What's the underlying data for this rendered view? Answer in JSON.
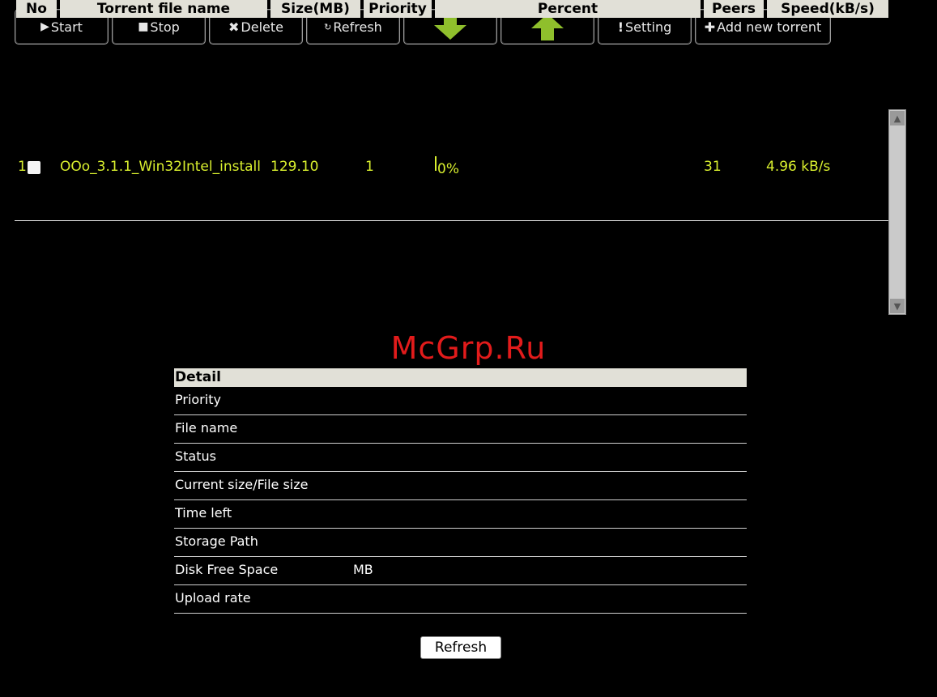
{
  "toolbar": {
    "start": "Start",
    "stop": "Stop",
    "delete": "Delete",
    "refresh": "Refresh",
    "setting": "Setting",
    "add": "Add new torrent",
    "icons": {
      "start": "play-icon",
      "stop": "stop-icon",
      "delete": "x-icon",
      "refresh": "refresh-icon",
      "down": "down-arrow-icon",
      "up": "up-arrow-icon",
      "setting": "exclamation-icon",
      "add": "plus-icon"
    },
    "arrow_color": "#8fbf2c"
  },
  "table": {
    "headers": [
      "No",
      "Torrent file name",
      "Size(MB)",
      "Priority",
      "Percent",
      "Peers",
      "Speed(kB/s)"
    ],
    "rows": [
      {
        "no": "1",
        "name": "OOo_3.1.1_Win32Intel_install",
        "size": "129.10",
        "priority": "1",
        "percent": "0%",
        "peers": "31",
        "speed": "4.96 kB/s"
      }
    ],
    "row_text_color": "#d9ef2e"
  },
  "watermark": "McGrp.Ru",
  "detail": {
    "title": "Detail",
    "rows": [
      {
        "label": "Priority",
        "value": ""
      },
      {
        "label": "File name",
        "value": ""
      },
      {
        "label": "Status",
        "value": ""
      },
      {
        "label": "Current size/File size",
        "value": ""
      },
      {
        "label": "Time left",
        "value": ""
      },
      {
        "label": "Storage Path",
        "value": ""
      },
      {
        "label": "Disk Free Space",
        "value": "MB"
      },
      {
        "label": "Upload rate",
        "value": ""
      }
    ]
  },
  "refresh_button": "Refresh"
}
